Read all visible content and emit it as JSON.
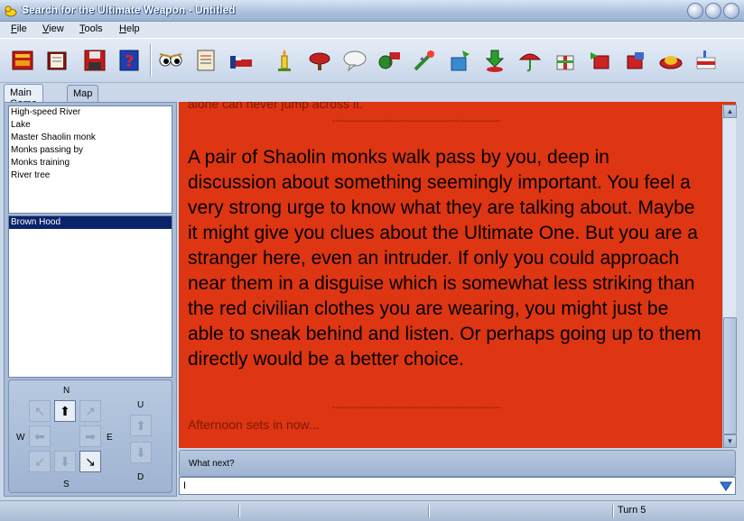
{
  "window": {
    "title": "Search for the Ultimate Weapon - Untitled"
  },
  "menu": [
    "File",
    "View",
    "Tools",
    "Help"
  ],
  "toolbar": {
    "icons": [
      "spellbook-icon",
      "notebook-icon",
      "save-disk-icon",
      "help-icon",
      "look-eyes-icon",
      "inventory-icon",
      "bed-icon",
      "candle-icon",
      "meat-icon",
      "talk-bubble-icon",
      "flag-icon",
      "magic-wand-icon",
      "put-box-icon",
      "drop-icon",
      "umbrella-icon",
      "gift-icon",
      "give-icon",
      "take-icon",
      "hat-icon",
      "cake-icon"
    ]
  },
  "tabs": [
    {
      "label": "Main Game",
      "active": true
    },
    {
      "label": "Map",
      "active": false
    }
  ],
  "objects": [
    "High-speed River",
    "Lake",
    "Master Shaolin monk",
    "Monks passing by",
    "Monks training",
    "River tree"
  ],
  "inventory": [
    {
      "label": "Brown Hood",
      "selected": true
    }
  ],
  "compass": {
    "n": "N",
    "s": "S",
    "e": "E",
    "w": "W",
    "u": "U",
    "d": "D"
  },
  "story": {
    "cut_top": "alone can never jump across it.",
    "rule": "--------------------------------------------------------",
    "main": "A pair of Shaolin monks walk pass by you, deep in discussion about something seemingly important. You feel a very strong urge to know what they are talking about. Maybe it might give you clues about the Ultimate One. But you are a stranger here, even an intruder. If only you could approach near them in a disguise which is somewhat less striking than the red civilian clothes you are wearing, you might just be able to sneak behind and listen. Or perhaps going up to them directly would be a better choice.",
    "footer": "Afternoon sets in now...",
    "bg_color": "#de3512"
  },
  "prompt": {
    "label": "What next?",
    "value": "I"
  },
  "status": {
    "turn": "Turn 5"
  }
}
